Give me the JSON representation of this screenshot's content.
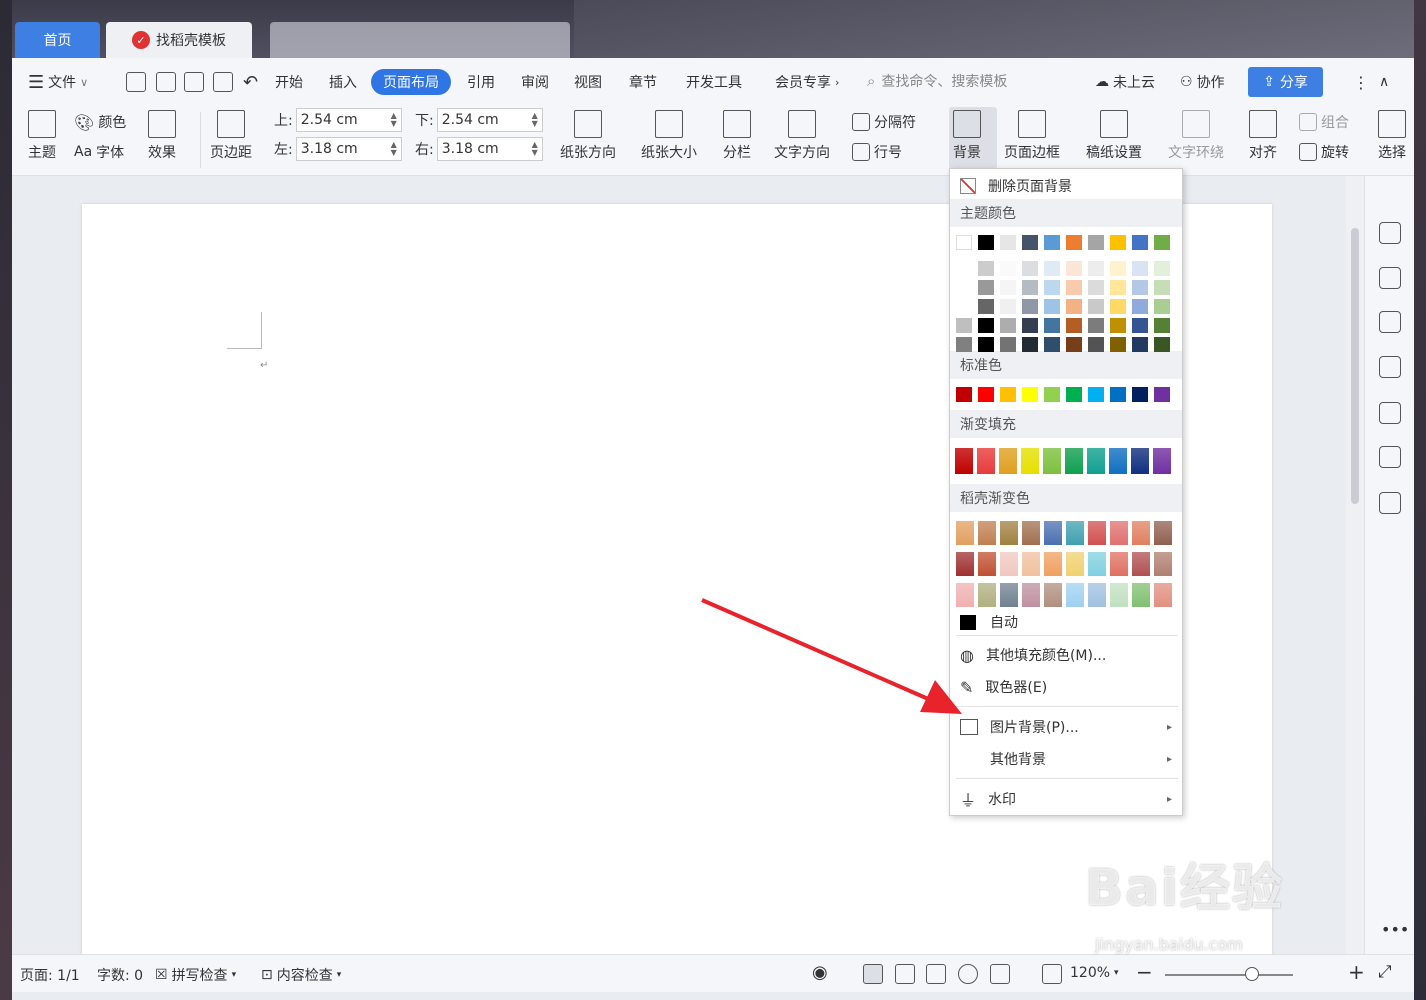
{
  "tabs": {
    "home": "首页",
    "template": "找稻壳模板"
  },
  "menu": {
    "file": "文件",
    "items": [
      "开始",
      "插入",
      "页面布局",
      "引用",
      "审阅",
      "视图",
      "章节",
      "开发工具",
      "会员专享"
    ],
    "search_placeholder": "查找命令、搜索模板",
    "cloud": "未上云",
    "collab": "协作",
    "share": "分享"
  },
  "ribbon": {
    "theme": "主题",
    "color": "颜色",
    "font": "字体",
    "effect": "效果",
    "margin": "页边距",
    "top_label": "上:",
    "top_value": "2.54 cm",
    "bottom_label": "下:",
    "bottom_value": "2.54 cm",
    "left_label": "左:",
    "left_value": "3.18 cm",
    "right_label": "右:",
    "right_value": "3.18 cm",
    "orientation": "纸张方向",
    "size": "纸张大小",
    "columns": "分栏",
    "text_dir": "文字方向",
    "separator": "分隔符",
    "line_no": "行号",
    "background": "背景",
    "border": "页面边框",
    "manuscript": "稿纸设置",
    "wrap": "文字环绕",
    "align": "对齐",
    "group": "组合",
    "rotate": "旋转",
    "select": "选择"
  },
  "dropdown": {
    "remove_bg": "删除页面背景",
    "theme_colors": "主题颜色",
    "standard_colors": "标准色",
    "gradient_fill": "渐变填充",
    "docer_gradient": "稻壳渐变色",
    "auto": "自动",
    "more_fill": "其他填充颜色(M)...",
    "picker": "取色器(E)",
    "picture_bg": "图片背景(P)...",
    "other_bg": "其他背景",
    "watermark": "水印",
    "theme_row": [
      "#ffffff",
      "#000000",
      "#e7e6e6",
      "#44546a",
      "#5b9bd5",
      "#ed7d31",
      "#a5a5a5",
      "#ffc000",
      "#4472c4",
      "#70ad47"
    ],
    "standard_row": [
      "#c00000",
      "#ff0000",
      "#ffc000",
      "#ffff00",
      "#92d050",
      "#00b050",
      "#00b0f0",
      "#0070c0",
      "#002060",
      "#7030a0"
    ],
    "gradient_row": [
      "#c00000",
      "#e83b3b",
      "#e0a020",
      "#e6e000",
      "#7ec040",
      "#10a050",
      "#10a090",
      "#1070c0",
      "#103080",
      "#7030a0"
    ]
  },
  "status": {
    "page": "页面: 1/1",
    "words": "字数: 0",
    "spell": "拼写检查",
    "content": "内容检查",
    "zoom": "120%"
  },
  "watermark_site": {
    "brand": "Bai经验",
    "url": "jingyan.baidu.com"
  }
}
